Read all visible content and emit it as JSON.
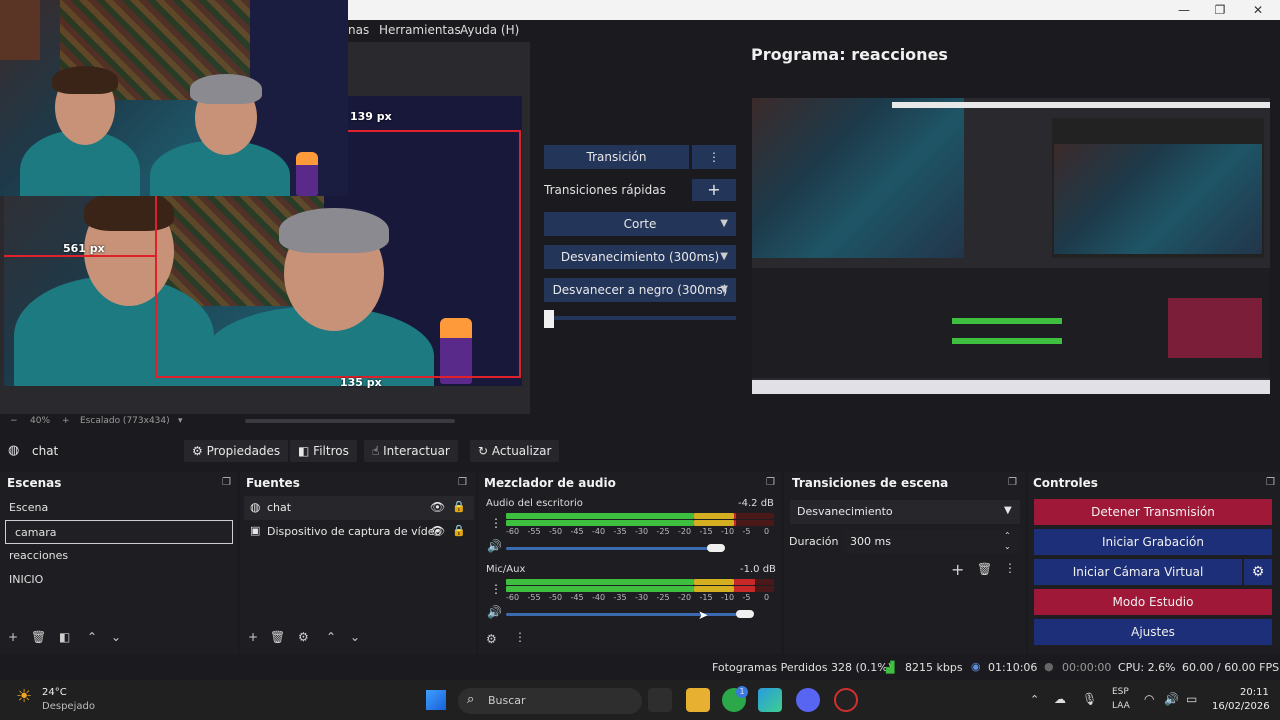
{
  "menu": {
    "item_partial": "nas",
    "tools": "Herramientas",
    "help": "Ayuda (H)"
  },
  "preview": {
    "measure_top": "139 px",
    "measure_left": "561 px",
    "measure_bottom": "135 px",
    "zoom": "40%",
    "scale": "Escalado (773x434)"
  },
  "transitions_panel": {
    "transition_label": "Transición",
    "quick_label": "Transiciones rápidas",
    "items": [
      "Corte",
      "Desvanecimiento (300ms)",
      "Desvanecer a negro (300ms)"
    ]
  },
  "program": {
    "title": "Programa: reacciones"
  },
  "source_toolbar": {
    "selected_source": "chat",
    "properties": "Propiedades",
    "filters": "Filtros",
    "interact": "Interactuar",
    "refresh": "Actualizar"
  },
  "scenes": {
    "title": "Escenas",
    "items": [
      "Escena",
      "camara",
      "reacciones",
      "INICIO"
    ]
  },
  "sources": {
    "title": "Fuentes",
    "items": [
      "chat",
      "Dispositivo de captura de vídeo"
    ]
  },
  "mixer": {
    "title": "Mezclador de audio",
    "tracks": [
      {
        "name": "Audio del escritorio",
        "db": "-4.2 dB",
        "level": 0.86,
        "volume": 0.92
      },
      {
        "name": "Mic/Aux",
        "db": "-1.0 dB",
        "level": 0.93,
        "volume": 0.92
      }
    ],
    "scale": [
      "-60",
      "-55",
      "-50",
      "-45",
      "-40",
      "-35",
      "-30",
      "-25",
      "-20",
      "-15",
      "-10",
      "-5",
      "0"
    ]
  },
  "scene_transitions": {
    "title": "Transiciones de escena",
    "selected": "Desvanecimiento",
    "duration_label": "Duración",
    "duration_value": "300 ms"
  },
  "controls": {
    "title": "Controles",
    "stop_stream": "Detener Transmisión",
    "start_recording": "Iniciar Grabación",
    "start_virtual_cam": "Iniciar Cámara Virtual",
    "studio_mode": "Modo Estudio",
    "settings": "Ajustes"
  },
  "status": {
    "dropped_frames": "Fotogramas Perdidos 328 (0.1%)",
    "bitrate": "8215 kbps",
    "stream_time": "01:10:06",
    "rec_time": "00:00:00",
    "cpu": "CPU: 2.6%",
    "fps": "60.00 / 60.00 FPS"
  },
  "taskbar": {
    "weather_temp": "24°C",
    "weather_desc": "Despejado",
    "search": "Buscar",
    "lang": "ESP",
    "lang_sub": "LAA",
    "time": "20:11",
    "date": "16/02/2026",
    "badge": "1"
  },
  "colors": {
    "accent_blue": "#24355a",
    "stop_red": "#a01838",
    "control_blue": "#1c2f78",
    "meter_green": "#3fbf3f",
    "meter_yellow": "#d4b020",
    "meter_red": "#c82828"
  }
}
